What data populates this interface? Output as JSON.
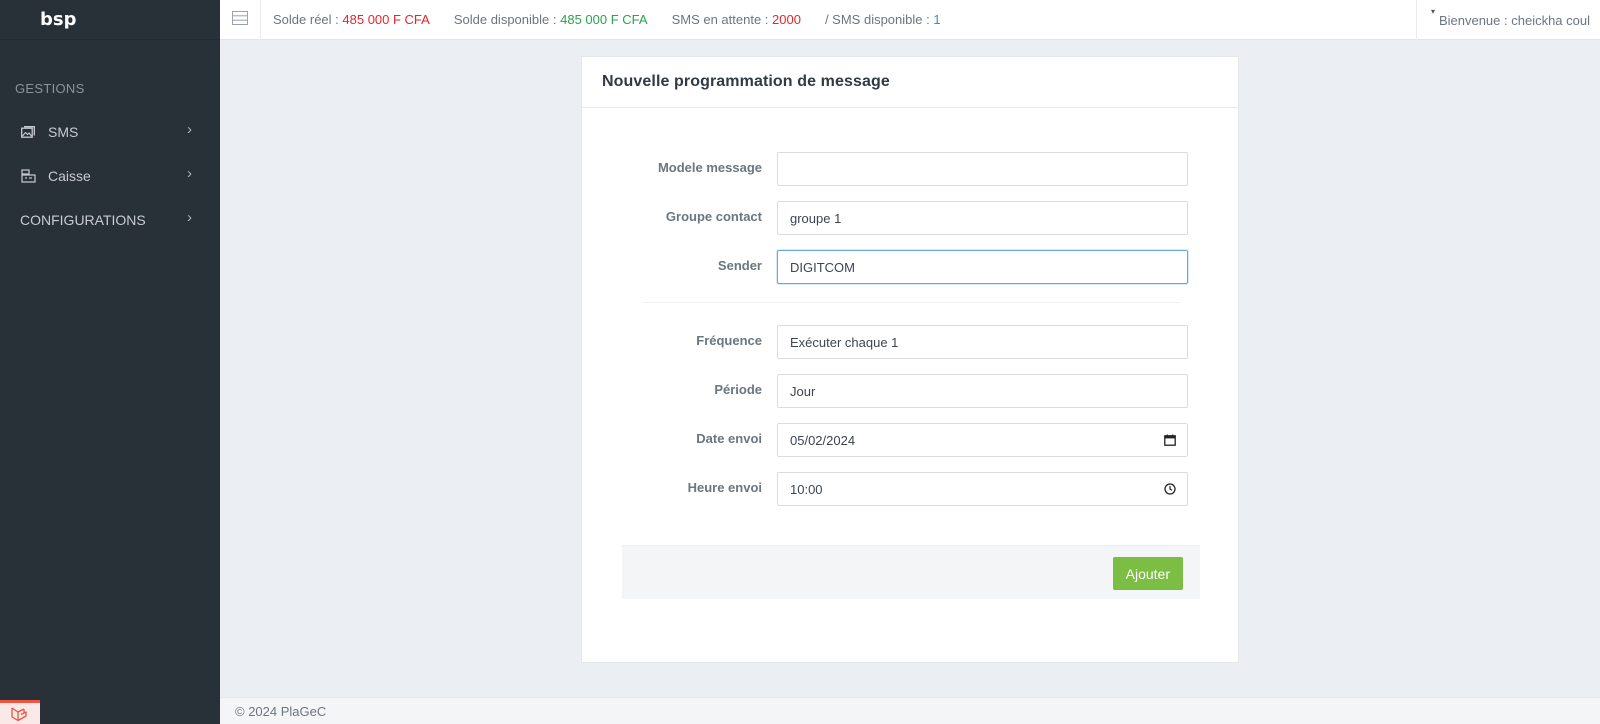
{
  "brand": "bsp",
  "sidebar": {
    "section_title": "GESTIONS",
    "items": [
      {
        "label": "SMS",
        "icon": "image-icon"
      },
      {
        "label": "Caisse",
        "icon": "cash-register-icon"
      },
      {
        "label": "CONFIGURATIONS",
        "icon": ""
      }
    ]
  },
  "topbar": {
    "solde_reel_label": "Solde réel :",
    "solde_reel_value": "485 000 F CFA",
    "solde_dispo_label": "Solde disponible :",
    "solde_dispo_value": "485 000 F CFA",
    "sms_attente_label": "SMS en attente :",
    "sms_attente_value": "2000",
    "sms_dispo_label": "/ SMS disponible :",
    "sms_dispo_value": "1",
    "welcome": "Bienvenue : cheickha coul"
  },
  "form": {
    "title": "Nouvelle programmation de message",
    "fields": [
      {
        "label": "Modele message",
        "value": ""
      },
      {
        "label": "Groupe contact",
        "value": "groupe 1"
      },
      {
        "label": "Sender",
        "value": "DIGITCOM"
      },
      {
        "label": "Fréquence",
        "value": "Exécuter chaque 1"
      },
      {
        "label": "Période",
        "value": "Jour"
      },
      {
        "label": "Date envoi",
        "value": "05/02/2024"
      },
      {
        "label": "Heure envoi",
        "value": "10:00"
      }
    ],
    "submit_label": "Ajouter"
  },
  "footer": "© 2024 PlaGeC",
  "colors": {
    "sidebar": "#283038",
    "accent_green": "#7cbd43",
    "value_red": "#e5262d",
    "value_green": "#2aa34c"
  }
}
